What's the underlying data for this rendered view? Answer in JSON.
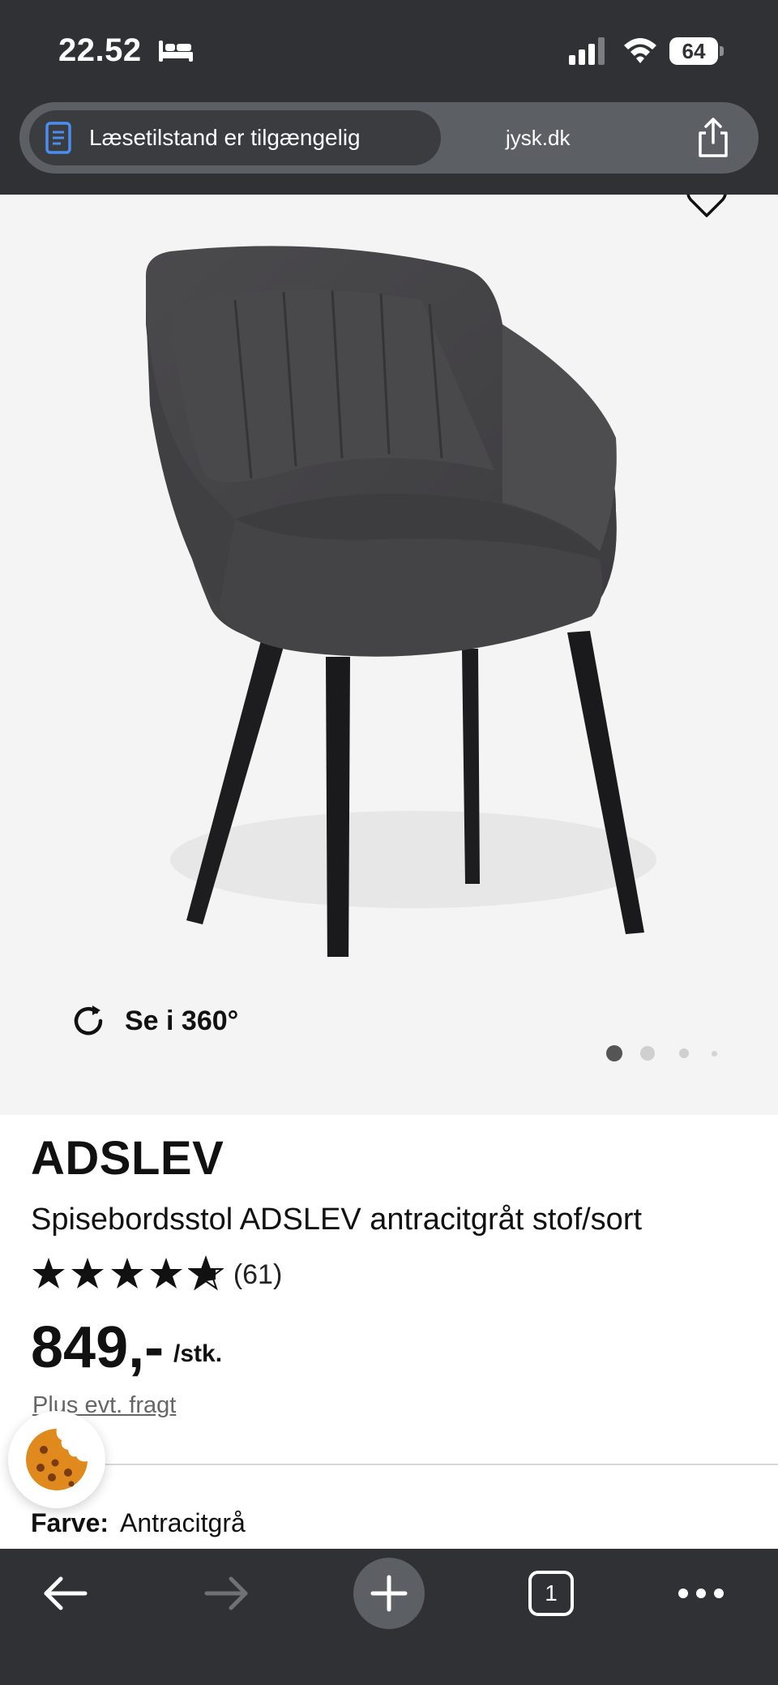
{
  "status_bar": {
    "time": "22.52",
    "battery": "64",
    "icons": [
      "bed-icon",
      "signal-icon",
      "wifi-icon",
      "battery-icon"
    ]
  },
  "address_bar": {
    "reader_label": "Læsetilstand er tilgængelig",
    "domain": "jysk.dk",
    "icons": [
      "reader-mode-icon",
      "share-icon"
    ]
  },
  "gallery": {
    "rotate_label": "Se i 360°",
    "pages_total": 4,
    "current_page": 1,
    "icons": [
      "heart-icon",
      "rotate-icon"
    ]
  },
  "product": {
    "brand": "ADSLEV",
    "subtitle": "Spisebordsstol ADSLEV antracitgråt stof/sort",
    "rating_stars": 4.5,
    "rating_count": "(61)",
    "price": "849,-",
    "unit": "/stk.",
    "shipping": "Plus evt. fragt",
    "color_key": "Farve:",
    "color_value": "Antracitgrå"
  },
  "toolbar": {
    "tab_count": "1",
    "icons": [
      "back-arrow-icon",
      "forward-arrow-icon",
      "new-tab-plus-icon",
      "tabs-icon",
      "more-icon"
    ]
  },
  "colors": {
    "chrome": "#2f3135",
    "address_bar": "#5c5f64",
    "image_bg": "#f4f4f4",
    "cookie": "#e08a1e"
  }
}
